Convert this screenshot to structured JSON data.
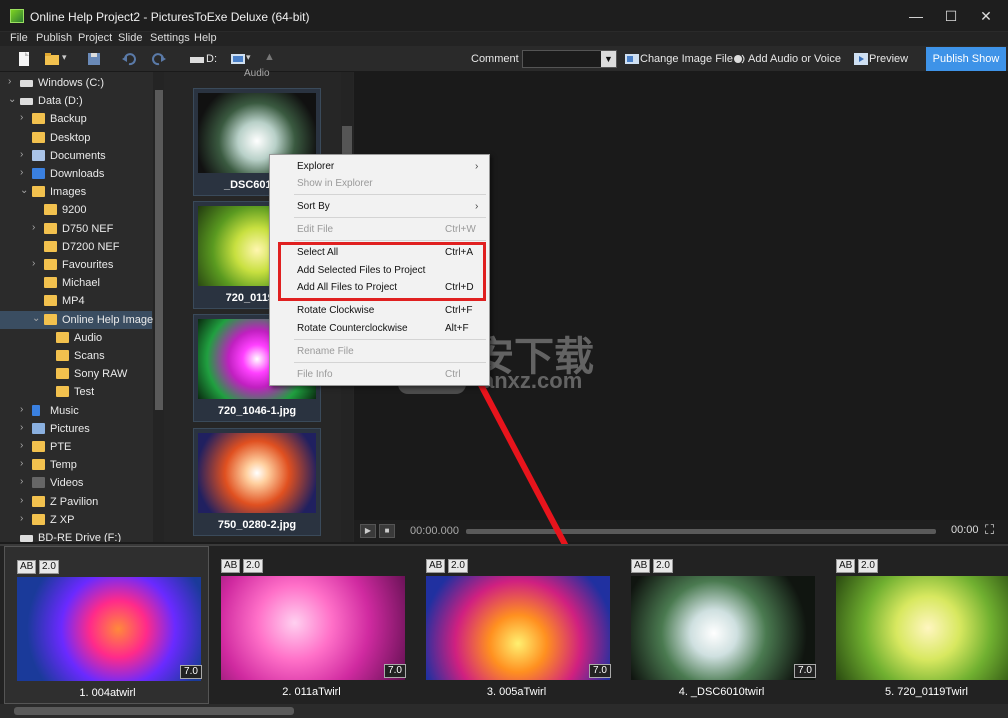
{
  "window": {
    "title": "Online Help Project2 - PicturesToExe Deluxe (64-bit)",
    "minimize": "—",
    "maximize": "☐",
    "close": "✕"
  },
  "menu": [
    "File",
    "Publish",
    "Project",
    "Slide",
    "Settings",
    "Help"
  ],
  "toolbar": {
    "drive_label": "D:",
    "comment_label": "Comment",
    "comment_value": "",
    "change_image": "Change Image File",
    "add_audio": "Add Audio or Voice",
    "preview": "Preview",
    "publish": "Publish Show"
  },
  "tree": [
    {
      "label": "Windows (C:)",
      "chev": "›",
      "icon": "drive"
    },
    {
      "label": "Data (D:)",
      "chev": "⌄",
      "icon": "drive"
    },
    {
      "label": "Backup",
      "chev": "›",
      "icon": "folder"
    },
    {
      "label": "Desktop",
      "chev": "",
      "icon": "folder"
    },
    {
      "label": "Documents",
      "chev": "›",
      "icon": "doc"
    },
    {
      "label": "Downloads",
      "chev": "›",
      "icon": "download"
    },
    {
      "label": "Images",
      "chev": "⌄",
      "icon": "folder"
    },
    {
      "label": "9200",
      "chev": "",
      "icon": "folder"
    },
    {
      "label": "D750 NEF",
      "chev": "›",
      "icon": "folder"
    },
    {
      "label": "D7200 NEF",
      "chev": "",
      "icon": "folder"
    },
    {
      "label": "Favourites",
      "chev": "›",
      "icon": "folder"
    },
    {
      "label": "Michael",
      "chev": "",
      "icon": "folder"
    },
    {
      "label": "MP4",
      "chev": "",
      "icon": "folder"
    },
    {
      "label": "Online Help Images",
      "chev": "⌄",
      "icon": "folder",
      "selected": true
    },
    {
      "label": "Audio",
      "chev": "",
      "icon": "folder"
    },
    {
      "label": "Scans",
      "chev": "",
      "icon": "folder"
    },
    {
      "label": "Sony RAW",
      "chev": "",
      "icon": "folder"
    },
    {
      "label": "Test",
      "chev": "",
      "icon": "folder"
    },
    {
      "label": "Music",
      "chev": "›",
      "icon": "music"
    },
    {
      "label": "Pictures",
      "chev": "›",
      "icon": "pictures"
    },
    {
      "label": "PTE",
      "chev": "›",
      "icon": "folder"
    },
    {
      "label": "Temp",
      "chev": "›",
      "icon": "folder"
    },
    {
      "label": "Videos",
      "chev": "›",
      "icon": "video"
    },
    {
      "label": "Z Pavilion",
      "chev": "›",
      "icon": "folder"
    },
    {
      "label": "Z XP",
      "chev": "›",
      "icon": "folder"
    },
    {
      "label": "BD-RE Drive (F:)",
      "chev": "",
      "icon": "drive"
    }
  ],
  "thumb_header": "Audio",
  "thumbs": [
    {
      "label": "_DSC6010tw",
      "grad": "radial-gradient(circle at 50% 60%, #fff 0%, #b8d0c8 25%, #3a5a40 50%, #111 80%)"
    },
    {
      "label": "720_0119Tw",
      "grad": "radial-gradient(circle at 50% 55%, #fff6b0 0%, #c8e040 30%, #5a9a20 60%, #223a10 100%)"
    },
    {
      "label": "720_1046-1.jpg",
      "grad": "radial-gradient(circle at 50% 50%, #ffffff 0%, #ff40ff 20%, #c020c0 40%, #20a040 70%, #0a2a10 100%)"
    },
    {
      "label": "750_0280-2.jpg",
      "grad": "radial-gradient(circle at 50% 50%, #fff 0%, #ffd0a0 15%, #e05020 45%, #202060 85%)"
    }
  ],
  "context_menu": [
    {
      "label": "Explorer",
      "shortcut": "",
      "submenu": true,
      "disabled": false
    },
    {
      "label": "Show in Explorer",
      "shortcut": "",
      "submenu": false,
      "disabled": true
    },
    {
      "label": "Sort By",
      "shortcut": "",
      "submenu": true,
      "disabled": false
    },
    {
      "label": "Edit File",
      "shortcut": "Ctrl+W",
      "submenu": false,
      "disabled": true
    },
    {
      "label": "Select All",
      "shortcut": "Ctrl+A",
      "submenu": false,
      "disabled": false
    },
    {
      "label": "Add Selected Files to Project",
      "shortcut": "",
      "submenu": false,
      "disabled": false
    },
    {
      "label": "Add All Files to Project",
      "shortcut": "Ctrl+D",
      "submenu": false,
      "disabled": false
    },
    {
      "label": "Rotate Clockwise",
      "shortcut": "Ctrl+F",
      "submenu": false,
      "disabled": false
    },
    {
      "label": "Rotate Counterclockwise",
      "shortcut": "Alt+F",
      "submenu": false,
      "disabled": false
    },
    {
      "label": "Rename File",
      "shortcut": "",
      "submenu": false,
      "disabled": true
    },
    {
      "label": "File Info",
      "shortcut": "Ctrl",
      "submenu": false,
      "disabled": true
    }
  ],
  "player": {
    "time_start": "00:00.000",
    "time_end": "00:00"
  },
  "watermark": {
    "main": "安下载",
    "sub": "anxz.com"
  },
  "slides": [
    {
      "label": "1. 004atwirl",
      "ab": "AB",
      "num": "2.0",
      "dur": "7.0",
      "grad": "radial-gradient(circle at 55% 50%, #ff8a3a 0%, #ff2a8a 25%, #6a2aff 50%, #1a3a9a 80%)"
    },
    {
      "label": "2. 011aTwirl",
      "ab": "AB",
      "num": "2.0",
      "dur": "7.0",
      "grad": "radial-gradient(circle at 40% 45%, #ffd0f0 0%, #ff70c8 30%, #d02aa0 60%, #601050 100%)"
    },
    {
      "label": "3. 005aTwirl",
      "ab": "AB",
      "num": "2.0",
      "dur": "7.0",
      "grad": "radial-gradient(circle at 50% 65%, #fff070 0%, #ff9020 25%, #d02080 55%, #2030a0 85%)"
    },
    {
      "label": "4. _DSC6010twirl",
      "ab": "AB",
      "num": "2.0",
      "dur": "7.0",
      "grad": "radial-gradient(circle at 45% 55%, #ffffff 0%, #cfe0e0 20%, #4a7a50 45%, #101510 80%)"
    },
    {
      "label": "5. 720_0119Twirl",
      "ab": "AB",
      "num": "2.0",
      "dur": "",
      "grad": "radial-gradient(circle at 50% 50%, #fff6c0 0%, #d8e860 30%, #70b030 60%, #2a4a10 100%)"
    }
  ]
}
